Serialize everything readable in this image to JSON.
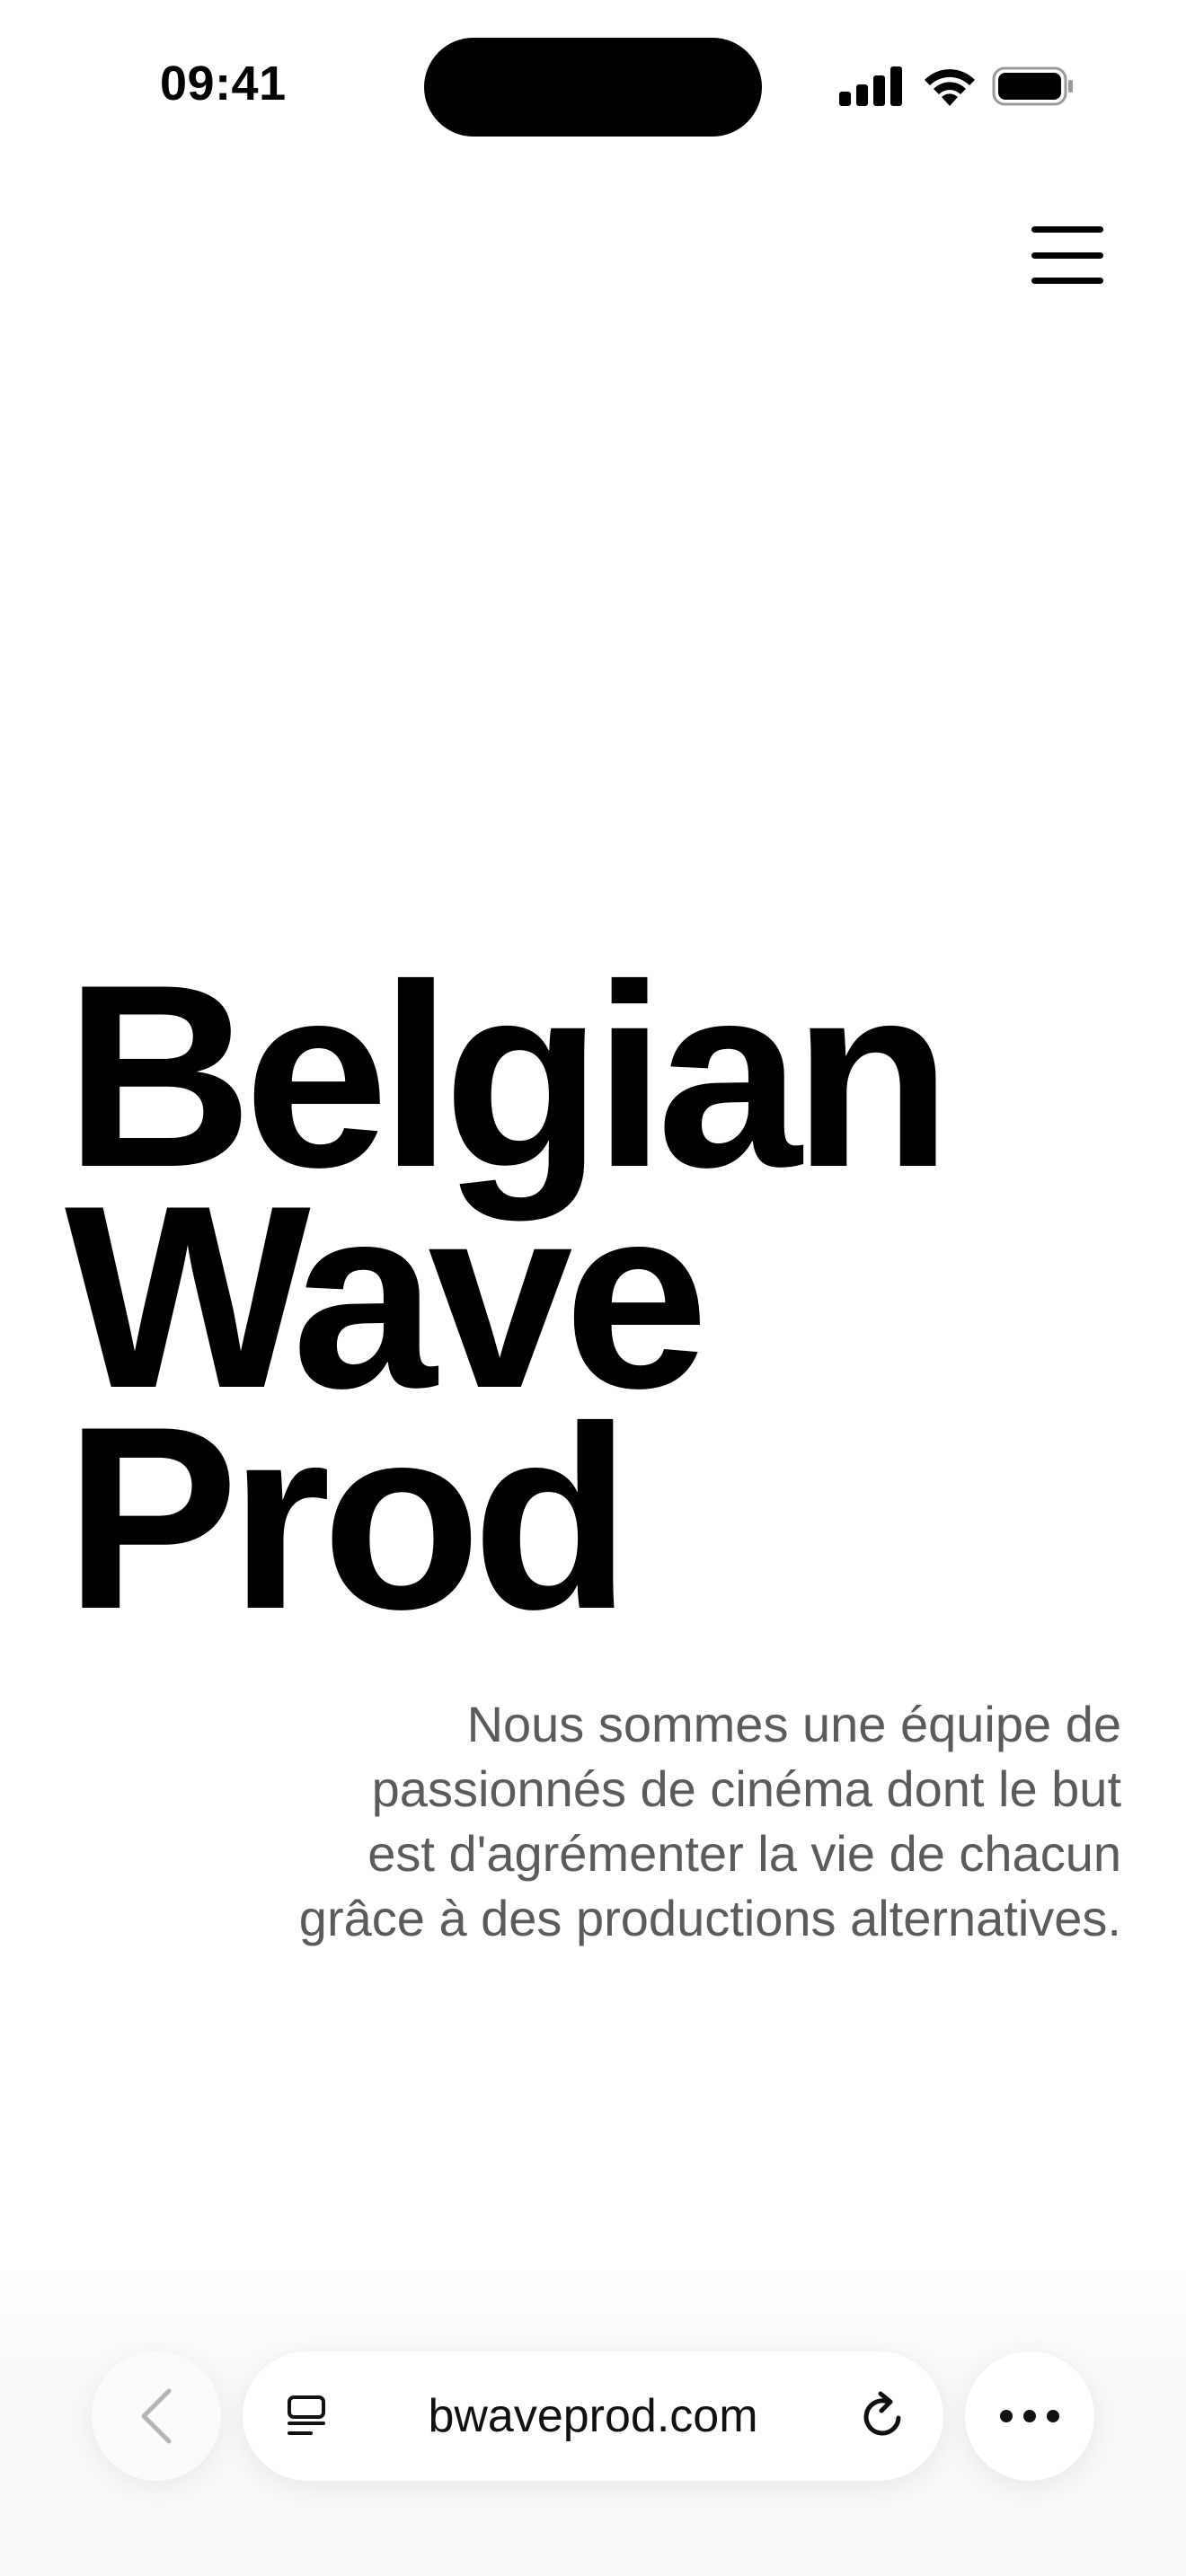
{
  "status_bar": {
    "time": "09:41",
    "icons": [
      "signal-icon",
      "wifi-icon",
      "battery-icon"
    ]
  },
  "header": {
    "menu_icon": "hamburger-menu-icon"
  },
  "hero": {
    "title_lines": [
      "Belgian",
      "Wave",
      "Prod"
    ],
    "description_lines": [
      "Nous sommes une équipe de",
      "passionnés de cinéma dont le but",
      "est d'agrémenter la vie de chacun",
      "grâce à des productions alternatives."
    ]
  },
  "browser_bar": {
    "back_icon": "chevron-left-icon",
    "tabs_icon": "tabs-icon",
    "url": "bwaveprod.com",
    "reload_icon": "reload-icon",
    "more_icon": "more-icon"
  },
  "colors": {
    "text": "#000000",
    "description": "#5b5b5b",
    "background": "#ffffff",
    "disabled_icon": "#b5b5b5"
  }
}
